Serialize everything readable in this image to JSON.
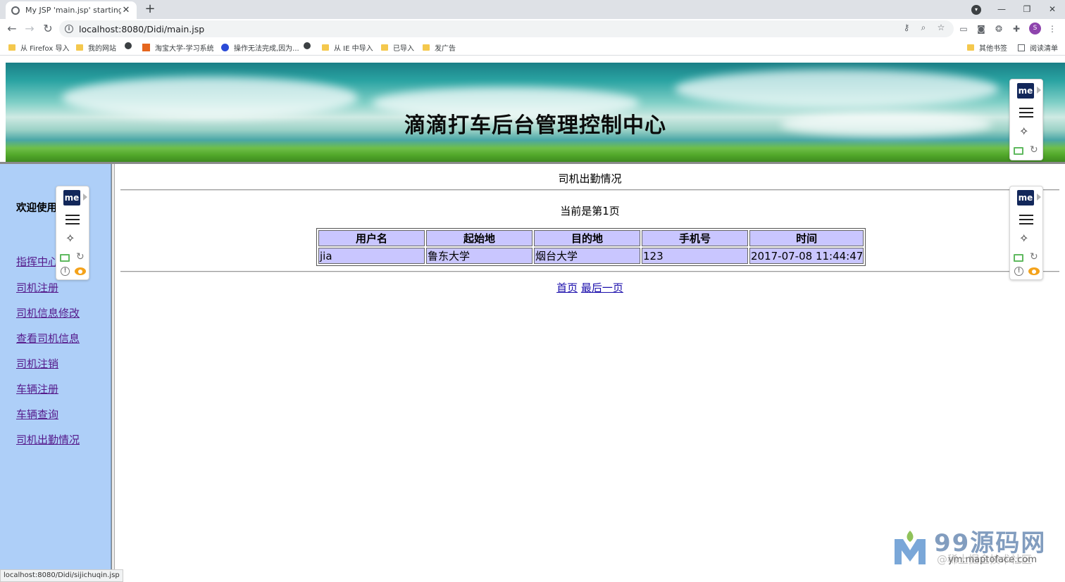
{
  "browser": {
    "tab_title": "My JSP 'main.jsp' starting pag",
    "tab_close": "✕",
    "new_tab": "+",
    "url": "localhost:8080/Didi/main.jsp",
    "profile_initial": "S",
    "window_controls": {
      "minimize": "—",
      "restore": "❐",
      "close": "✕"
    }
  },
  "bookmarks": [
    {
      "label": "从 Firefox 导入",
      "icon": "folder-icon"
    },
    {
      "label": "我的网站",
      "icon": "folder-icon"
    },
    {
      "label": "",
      "icon": "globe-icon"
    },
    {
      "label": "淘宝大学-学习系统",
      "icon": "taobao-icon"
    },
    {
      "label": "操作无法完成,因为...",
      "icon": "baidu-icon"
    },
    {
      "label": "",
      "icon": "globe-icon"
    },
    {
      "label": "从 IE 中导入",
      "icon": "folder-icon"
    },
    {
      "label": "已导入",
      "icon": "folder-icon"
    },
    {
      "label": "发广告",
      "icon": "folder-icon"
    },
    {
      "label": "其他书签",
      "icon": "folder-icon"
    },
    {
      "label": "阅读清单",
      "icon": "reading-list-icon"
    }
  ],
  "banner": {
    "title": "滴滴打车后台管理控制中心"
  },
  "sidebar": {
    "welcome": "欢迎使用",
    "links": [
      "指挥中心",
      "司机注册",
      "司机信息修改",
      "查看司机信息",
      "司机注销",
      "车辆注册",
      "车辆查询",
      "司机出勤情况"
    ]
  },
  "main": {
    "section_title": "司机出勤情况",
    "page_info": "当前是第1页",
    "table": {
      "headers": [
        "用户名",
        "起始地",
        "目的地",
        "手机号",
        "时间"
      ],
      "rows": [
        [
          "jia",
          "鲁东大学",
          "烟台大学",
          "123",
          "2017-07-08 11:44:47"
        ]
      ]
    },
    "pager": {
      "first": "首页",
      "last": "最后一页"
    }
  },
  "extension": {
    "label": "me"
  },
  "status_url": "localhost:8080/Didi/sijichuqin.jsp",
  "watermark": {
    "name": "99源码网",
    "url": "ym.maptoface.com",
    "overlay": "@稀土掘金技术社区"
  },
  "colors": {
    "sidebar_bg": "#aecff8",
    "table_cell_bg": "#c9c6ff",
    "link_visited": "#551a8b",
    "link": "#1a0dab"
  }
}
